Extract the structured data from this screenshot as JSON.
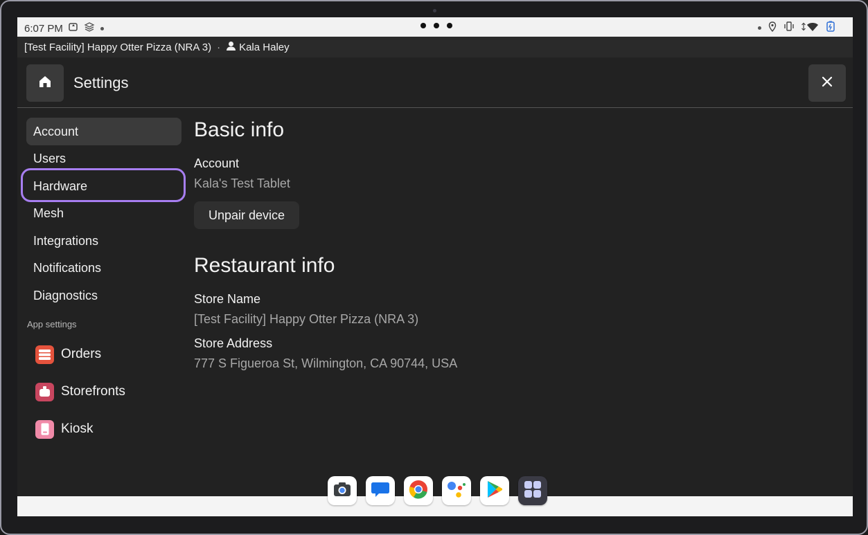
{
  "status_bar": {
    "time": "6:07 PM"
  },
  "facility_bar": {
    "facility": "[Test Facility] Happy Otter Pizza (NRA 3)",
    "separator": "·",
    "user": "Kala Haley"
  },
  "header": {
    "title": "Settings",
    "home_icon": "home-icon",
    "close_icon": "close-icon"
  },
  "sidebar": {
    "items": [
      {
        "label": "Account",
        "active": true
      },
      {
        "label": "Users"
      },
      {
        "label": "Hardware",
        "highlighted": true
      },
      {
        "label": "Mesh"
      },
      {
        "label": "Integrations"
      },
      {
        "label": "Notifications"
      },
      {
        "label": "Diagnostics"
      }
    ],
    "section_label": "App settings",
    "apps": [
      {
        "label": "Orders",
        "color": "#e5533d"
      },
      {
        "label": "Storefronts",
        "color": "#c8465f"
      },
      {
        "label": "Kiosk",
        "color": "#f08aa8"
      }
    ]
  },
  "main": {
    "basic_info": {
      "heading": "Basic info",
      "account_label": "Account",
      "account_value": "Kala's Test Tablet",
      "unpair_button": "Unpair device"
    },
    "restaurant_info": {
      "heading": "Restaurant info",
      "store_name_label": "Store Name",
      "store_name_value": "[Test Facility] Happy Otter Pizza (NRA 3)",
      "store_address_label": "Store Address",
      "store_address_value": "777 S Figueroa St, Wilmington, CA 90744, USA"
    }
  },
  "dock": {
    "apps": [
      "camera-icon",
      "messages-icon",
      "chrome-icon",
      "assistant-icon",
      "play-store-icon",
      "app-launcher-icon"
    ]
  },
  "colors": {
    "accent_highlight": "#a77ef0",
    "background": "#222222"
  }
}
